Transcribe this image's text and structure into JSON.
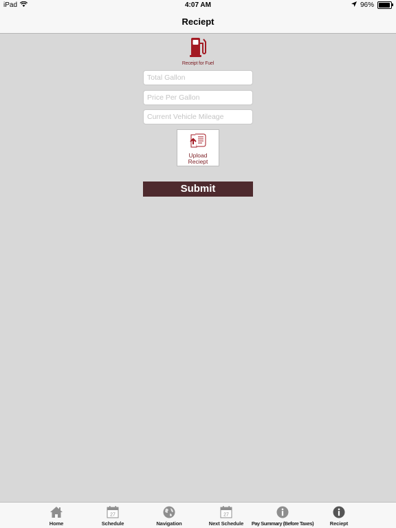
{
  "status_bar": {
    "device": "iPad",
    "time": "4:07 AM",
    "battery": "96%",
    "battery_level": 0.96,
    "icons": [
      "wifi-icon",
      "location-arrow-icon",
      "battery-icon"
    ]
  },
  "nav": {
    "title": "Reciept"
  },
  "header": {
    "icon": "fuel-pump-icon",
    "caption": "Receipt for Fuel"
  },
  "form": {
    "total_gallon": {
      "placeholder": "Total Gallon",
      "value": ""
    },
    "price_per_gallon": {
      "placeholder": "Price Per Gallon",
      "value": ""
    },
    "vehicle_mileage": {
      "placeholder": "Current Vehicle Mileage",
      "value": ""
    },
    "upload": {
      "line1": "Upload",
      "line2": "Reciept",
      "icon": "upload-receipt-icon"
    },
    "submit_label": "Submit"
  },
  "tabs": [
    {
      "label": "Home",
      "icon": "home-icon"
    },
    {
      "label": "Schedule",
      "icon": "calendar-icon",
      "icon_text": "27"
    },
    {
      "label": "Navigation",
      "icon": "globe-icon"
    },
    {
      "label": "Next Schedule",
      "icon": "calendar-icon",
      "icon_text": "27"
    },
    {
      "label": "Pay Summary (Before Taxes)",
      "icon": "info-icon"
    },
    {
      "label": "Reciept",
      "icon": "info-icon",
      "selected": true
    }
  ],
  "colors": {
    "background": "#d8d8d8",
    "brand_red": "#a31a23",
    "submit_bg": "#4e2a2e",
    "bar_bg": "#f7f7f7",
    "tab_icon_inactive": "#8e8e8e",
    "tab_icon_active": "#555555"
  }
}
